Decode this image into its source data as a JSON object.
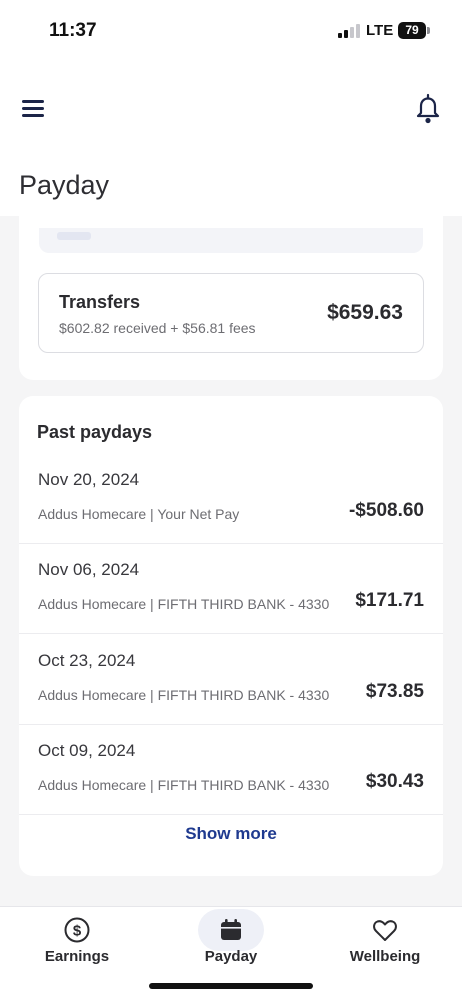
{
  "status_bar": {
    "time": "11:37",
    "network": "LTE",
    "battery": "79"
  },
  "header": {
    "title": "Payday"
  },
  "transfers": {
    "title": "Transfers",
    "subtitle": "$602.82 received + $56.81 fees",
    "amount": "$659.63"
  },
  "past_paydays": {
    "title": "Past paydays",
    "rows": [
      {
        "date": "Nov 20, 2024",
        "description": "Addus Homecare | Your Net Pay",
        "amount": "-$508.60"
      },
      {
        "date": "Nov 06, 2024",
        "description": "Addus Homecare | FIFTH THIRD BANK - 4330",
        "amount": "$171.71"
      },
      {
        "date": "Oct 23, 2024",
        "description": "Addus Homecare | FIFTH THIRD BANK - 4330",
        "amount": "$73.85"
      },
      {
        "date": "Oct 09, 2024",
        "description": "Addus Homecare | FIFTH THIRD BANK - 4330",
        "amount": "$30.43"
      }
    ],
    "show_more": "Show more"
  },
  "tabbar": {
    "tabs": [
      {
        "label": "Earnings",
        "icon": "dollar-circle-icon",
        "active": false
      },
      {
        "label": "Payday",
        "icon": "calendar-icon",
        "active": true
      },
      {
        "label": "Wellbeing",
        "icon": "heart-icon",
        "active": false
      }
    ]
  },
  "colors": {
    "accent": "#1f3a8f",
    "nav_icon": "#1c2548"
  }
}
